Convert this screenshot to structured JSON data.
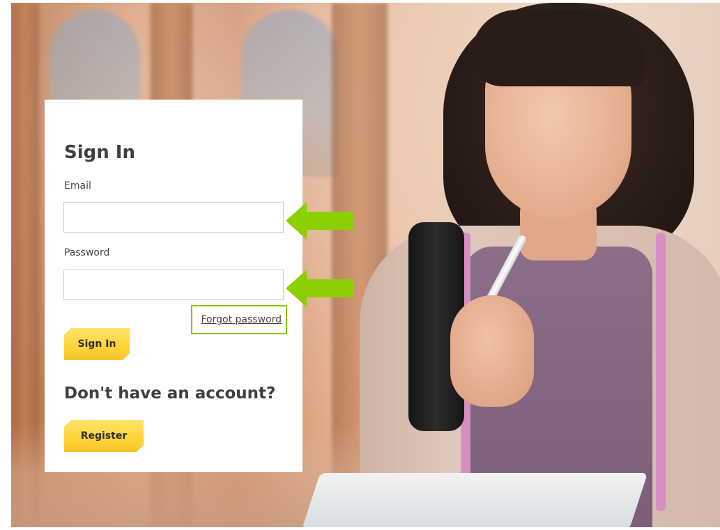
{
  "signin_card": {
    "title": "Sign In",
    "email_label": "Email",
    "email_value": "",
    "password_label": "Password",
    "password_value": "",
    "forgot_password": "Forgot password",
    "signin_button": "Sign In",
    "register_heading": "Don't have an account?",
    "register_button": "Register"
  },
  "annotations": {
    "arrow_color": "#8bd000",
    "highlight_color": "#8bc400",
    "arrows": [
      "email-arrow-icon",
      "password-arrow-icon"
    ]
  },
  "theme": {
    "button_color": "#ffd43b",
    "text_color": "#3f3f3f"
  }
}
